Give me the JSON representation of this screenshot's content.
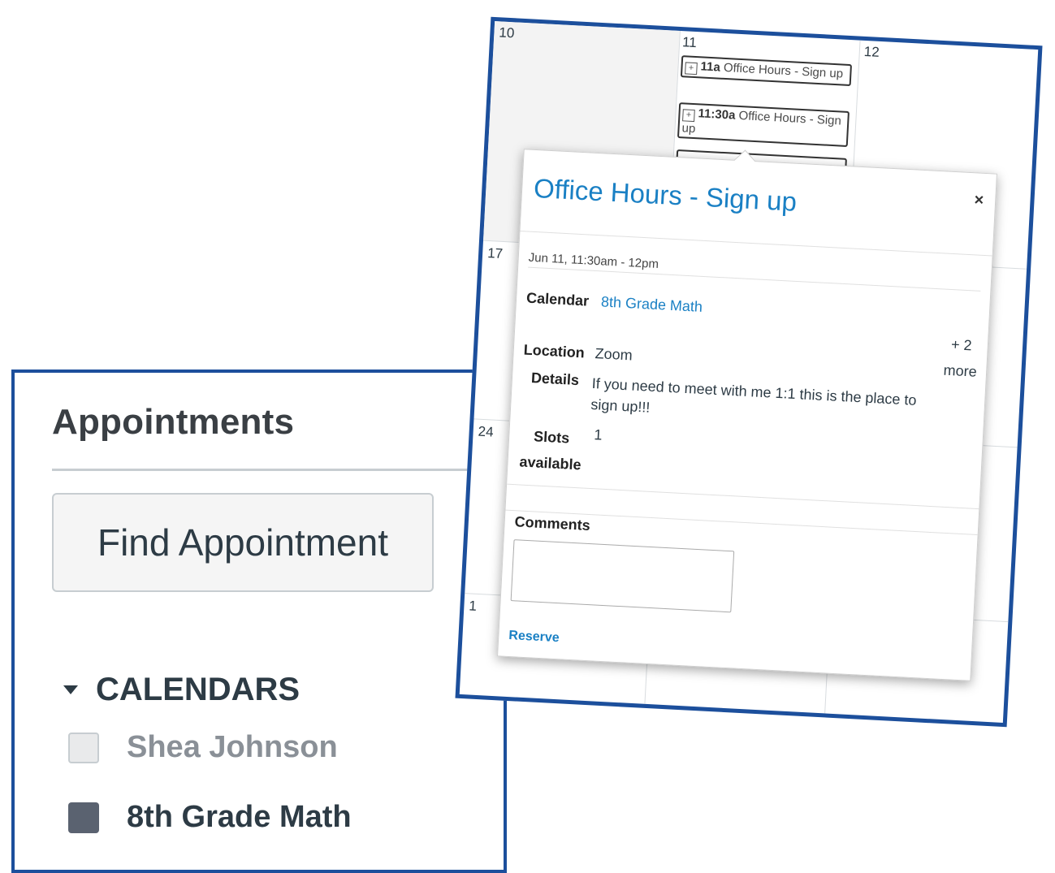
{
  "appointments": {
    "title": "Appointments",
    "find_button": "Find Appointment"
  },
  "calendars": {
    "header": "CALENDARS",
    "items": [
      {
        "label": "Shea Johnson",
        "checked": false,
        "color": "#e9eaeb"
      },
      {
        "label": "8th Grade Math",
        "checked": true,
        "color": "#5a6270"
      }
    ]
  },
  "calendar_grid": {
    "days": [
      "10",
      "11",
      "12",
      "17",
      "24",
      "1"
    ],
    "events": [
      {
        "time": "11a",
        "title": "Office Hours - Sign up"
      },
      {
        "time": "11:30a",
        "title": "Office Hours - Sign up"
      }
    ]
  },
  "popover": {
    "title": "Office Hours - Sign up",
    "close": "×",
    "date": "Jun 11, 11:30am - 12pm",
    "calendar_label": "Calendar",
    "calendar_value": "8th Grade Math",
    "more_top": "+ 2",
    "more_bottom": "more",
    "location_label": "Location",
    "location_value": "Zoom",
    "details_label": "Details",
    "details_value": "If you need to meet with me 1:1 this is the place to sign up!!!",
    "slots_label_1": "Slots",
    "slots_label_2": "available",
    "slots_value": "1",
    "comments_label": "Comments",
    "comments_value": "",
    "reserve": "Reserve"
  },
  "colors": {
    "frame_border": "#1c4f9c",
    "link": "#1a80c4"
  },
  "icons": {
    "event_icon": "calendar-plus-icon",
    "caret": "caret-down-icon",
    "close": "close-icon"
  }
}
